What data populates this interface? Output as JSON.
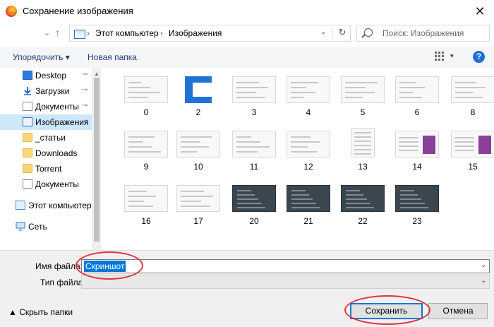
{
  "window": {
    "title": "Сохранение изображения",
    "close_glyph": "✕"
  },
  "nav": {
    "back": "←",
    "forward": "→",
    "recent": "⌄",
    "up": "↑",
    "refresh": "↻",
    "dropdown": "⌄"
  },
  "address": {
    "separator": "›",
    "crumbs": [
      "Этот компьютер",
      "Изображения"
    ]
  },
  "search": {
    "placeholder": "Поиск: Изображения"
  },
  "toolbar": {
    "organize": "Упорядочить ▾",
    "new_folder": "Новая папка",
    "view_dd": "▾",
    "help": "?"
  },
  "sidebar": {
    "pin_glyph": "📌",
    "items": [
      {
        "label": "Desktop",
        "icon": "desktop-icon",
        "pinned": true
      },
      {
        "label": "Загрузки",
        "icon": "downloads-icon",
        "pinned": true
      },
      {
        "label": "Документы",
        "icon": "documents-icon",
        "pinned": true
      },
      {
        "label": "Изображения",
        "icon": "pictures-icon",
        "pinned": true,
        "selected": true
      },
      {
        "label": "_статьи",
        "icon": "folder-icon"
      },
      {
        "label": "Downloads",
        "icon": "folder-icon"
      },
      {
        "label": "Torrent",
        "icon": "folder-icon"
      },
      {
        "label": "Документы",
        "icon": "documents-icon"
      },
      {
        "label": "Этот компьютер",
        "icon": "this-pc-icon"
      },
      {
        "label": "Сеть",
        "icon": "network-icon"
      }
    ]
  },
  "files": [
    "0",
    "2",
    "3",
    "4",
    "5",
    "6",
    "8",
    "9",
    "10",
    "11",
    "12",
    "13",
    "14",
    "15",
    "16",
    "17",
    "20",
    "21",
    "22",
    "23"
  ],
  "form": {
    "filename_label": "Имя файла:",
    "filename_value": "Скриншот",
    "filetype_label": "Тип файла:",
    "filetype_value": "",
    "dropdown": "⌄"
  },
  "footer": {
    "hide_folders": "▲  Скрыть папки",
    "save": "Сохранить",
    "cancel": "Отмена"
  },
  "colors": {
    "accent": "#0078d7",
    "highlight": "#e0343c",
    "selected": "#cde8fb"
  }
}
